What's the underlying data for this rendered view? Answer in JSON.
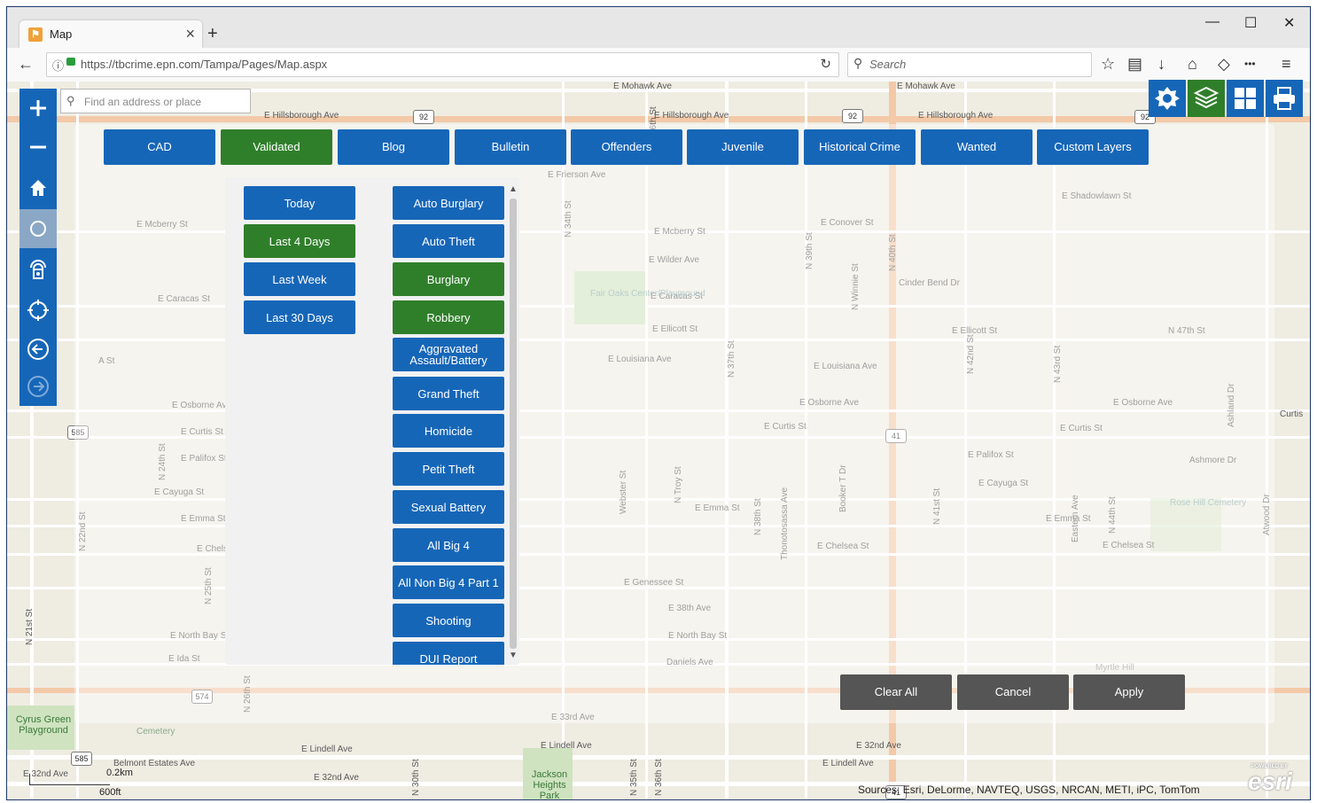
{
  "browser": {
    "tab_title": "Map",
    "tab_close": "×",
    "new_tab": "+",
    "url": "https://tbcrime.epn.com/Tampa/Pages/Map.aspx",
    "search_placeholder": "Search",
    "window_controls": [
      "—",
      "☐",
      "✕"
    ]
  },
  "map": {
    "find_placeholder": "Find an address or place",
    "attribution": "Sources: Esri, DeLorme, NAVTEQ, USGS, NRCAN, METI, iPC, TomTom",
    "logo": "esri",
    "logo_small": "POWERED BY",
    "scale": {
      "km": "0.2km",
      "ft": "600ft"
    },
    "street_labels": {
      "mohawk_1": "E Mohawk Ave",
      "mohawk_2": "E Mohawk Ave",
      "hillsborough_1": "E Hillsborough Ave",
      "hillsborough_2": "E Hillsborough Ave",
      "hillsborough_3": "E Hillsborough Ave",
      "frierson": "E Frierson Ave",
      "mcberry_1": "E Mcberry St",
      "mcberry_2": "E Mcberry St",
      "conover": "E Conover St",
      "shadowlawn": "E Shadowlawn St",
      "wilder": "E Wilder Ave",
      "caracas_1": "E Caracas St",
      "caracas_2": "E Caracas St",
      "cinder": "Cinder Bend Dr",
      "ellicott_1": "E Ellicott St",
      "ellicott_2": "E Ellicott St",
      "n47": "N 47th St",
      "a_st": "A St",
      "louisiana_1": "E Louisiana Ave",
      "louisiana_2": "E Louisiana Ave",
      "osborne_1": "E Osborne Ave",
      "osborne_2": "E Osborne Ave",
      "osborne_3": "E Osborne Ave",
      "curtis_1": "E Curtis St",
      "curtis_2": "E Curtis St",
      "curtis_3": "E Curtis St",
      "curtis_4": "Curtis",
      "palifox_1": "E Palifox St",
      "palifox_2": "E Palifox St",
      "ashmore": "Ashmore Dr",
      "cayuga_1": "E Cayuga St",
      "cayuga_2": "E Cayuga St",
      "emma_1": "E Emma St",
      "emma_2": "E Emma St",
      "emma_3": "E Emma St",
      "chelsea_1": "E Chelsea St",
      "chelsea_2": "E Chelsea St",
      "genessee": "E Genessee St",
      "n38th_ave": "E 38th Ave",
      "northbay": "E North Bay St",
      "northbay_2": "E North Bay St",
      "ida": "E Ida St",
      "daniels": "Daniels Ave",
      "e33rd": "E 33rd Ave",
      "lindell_1": "E Lindell Ave",
      "lindell_2": "E Lindell Ave",
      "lindell_3": "E Lindell Ave",
      "e32nd_1": "E 32nd Ave",
      "e32nd_2": "E 32nd Ave",
      "e32nd_3": "E 32nd Ave",
      "belmont": "Belmont Estates Ave",
      "park_fairoaks": "Fair Oaks Center/Playground",
      "park_cyrus": "Cyrus Green Playground",
      "park_jackson": "Jackson Heights Park",
      "cemetery": "Cemetery",
      "rosehill": "Rose Hill Cemetery",
      "myrtle": "Myrtle Hill",
      "n21": "N 21st St",
      "n22": "N 22nd St",
      "n24": "N 24th St",
      "n25": "N 25th St",
      "n26": "N 26th St",
      "n30": "N 30th St",
      "n34": "N 34th St",
      "n35": "N 35th St",
      "n36": "N 36th St",
      "n37": "N 37th St",
      "n38": "N 38th St",
      "n39": "N 39th St",
      "n40": "N 40th St",
      "n41": "N 41st St",
      "n42": "N 42nd St",
      "n43": "N 43rd St",
      "n44": "N 44th St",
      "webster": "Webster St",
      "ntroy": "N Troy St",
      "thonotosassa": "Thonotosassa Ave",
      "booker": "Booker T Dr",
      "winnie": "N Winnie St",
      "eastern": "Eastern Ave",
      "atwood": "Atwood Dr",
      "ashland": "Ashland Dr"
    },
    "shields": [
      "92",
      "92",
      "92",
      "41",
      "585",
      "574",
      "585",
      "41"
    ]
  },
  "top_tabs": [
    {
      "label": "CAD",
      "selected": false
    },
    {
      "label": "Validated",
      "selected": true
    },
    {
      "label": "Blog",
      "selected": false
    },
    {
      "label": "Bulletin",
      "selected": false
    },
    {
      "label": "Offenders",
      "selected": false
    },
    {
      "label": "Juvenile",
      "selected": false
    },
    {
      "label": "Historical Crime",
      "selected": false
    },
    {
      "label": "Wanted",
      "selected": false
    },
    {
      "label": "Custom Layers",
      "selected": false
    }
  ],
  "date_filters": [
    {
      "label": "Today",
      "selected": false
    },
    {
      "label": "Last 4 Days",
      "selected": true
    },
    {
      "label": "Last Week",
      "selected": false
    },
    {
      "label": "Last 30 Days",
      "selected": false
    }
  ],
  "crime_types": [
    {
      "label": "Auto Burglary",
      "selected": false
    },
    {
      "label": "Auto Theft",
      "selected": false
    },
    {
      "label": "Burglary",
      "selected": true
    },
    {
      "label": "Robbery",
      "selected": true
    },
    {
      "label": "Aggravated Assault/Battery",
      "selected": false
    },
    {
      "label": "Grand Theft",
      "selected": false
    },
    {
      "label": "Homicide",
      "selected": false
    },
    {
      "label": "Petit Theft",
      "selected": false
    },
    {
      "label": "Sexual Battery",
      "selected": false
    },
    {
      "label": "All Big 4",
      "selected": false
    },
    {
      "label": "All Non Big 4 Part 1",
      "selected": false
    },
    {
      "label": "Shooting",
      "selected": false
    },
    {
      "label": "DUI Report",
      "selected": false
    }
  ],
  "actions": {
    "clear_all": "Clear All",
    "cancel": "Cancel",
    "apply": "Apply"
  },
  "colors": {
    "primary_blue": "#1666b8",
    "selected_green": "#2f7f2a",
    "action_gray": "#555555"
  },
  "icons": [
    "zoom-in-icon",
    "zoom-out-icon",
    "home-icon",
    "street-view-icon",
    "locate-icon",
    "crosshair-icon",
    "back-icon",
    "forward-icon",
    "police-badge-icon",
    "layers-icon",
    "grid-icon",
    "print-icon"
  ]
}
